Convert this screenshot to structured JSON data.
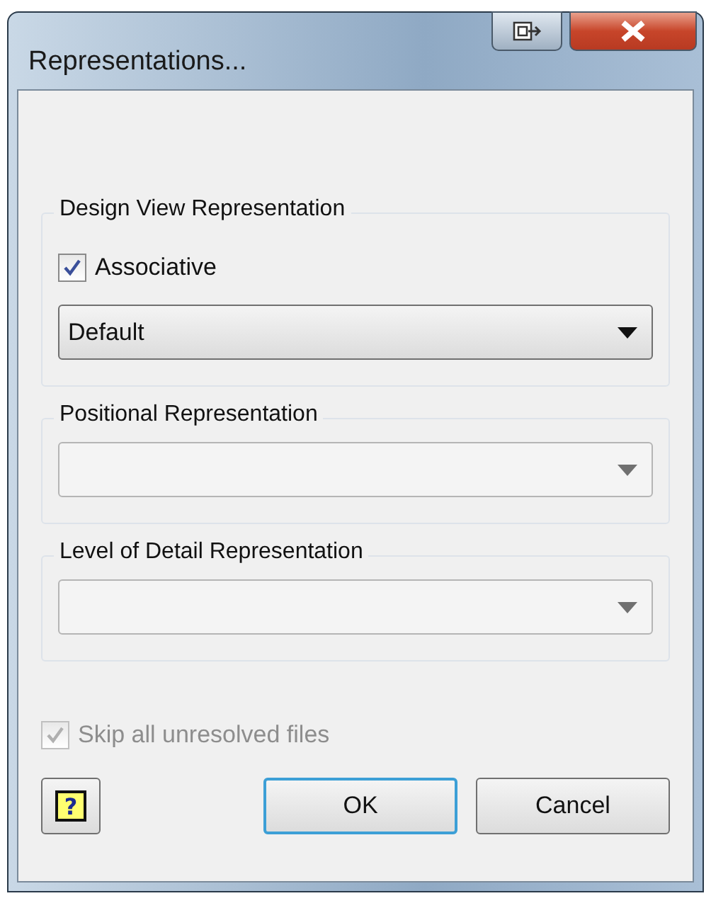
{
  "window": {
    "title": "Representations..."
  },
  "groups": [
    {
      "title": "Design View Representation",
      "checkbox": {
        "label": "Associative",
        "checked": true,
        "disabled": false
      },
      "combo": {
        "value": "Default",
        "disabled": false
      }
    },
    {
      "title": "Positional Representation",
      "combo": {
        "disabled": true
      }
    },
    {
      "title": "Level of Detail Representation",
      "combo": {
        "disabled": true
      }
    }
  ],
  "skip_checkbox": {
    "label": "Skip all unresolved files",
    "checked": true,
    "disabled": true
  },
  "help_button": {
    "glyph": "?"
  },
  "buttons": [
    {
      "label": "OK",
      "default": true
    },
    {
      "label": "Cancel",
      "default": false
    }
  ]
}
